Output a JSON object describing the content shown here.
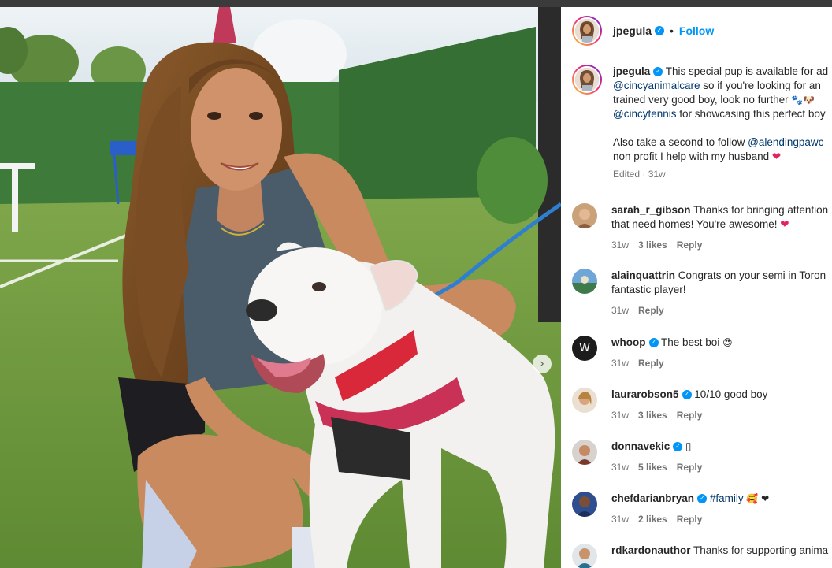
{
  "post": {
    "author": "jpegula",
    "follow_label": "Follow",
    "separator": "•",
    "verified_glyph": "✓",
    "next_glyph": "›",
    "caption": {
      "line1_text": "This special pup is available for ad",
      "line2_mention": "@cincyanimalcare",
      "line2_text": " so if you're looking for an",
      "line3_text": "trained very good boy, look no further",
      "line3_emoji": "🐾🐶",
      "line4_mention": "@cincytennis",
      "line4_text": " for showcasing this perfect boy",
      "line5_text": "Also take a second to follow ",
      "line5_mention": "@alendingpawc",
      "line6_text": "non profit I help with my husband",
      "line6_emoji": "❤",
      "edited": "Edited · 31w"
    }
  },
  "comments": [
    {
      "user": "sarah_r_gibson",
      "verified": false,
      "text": "Thanks for bringing attention",
      "text2": "that need homes! You're awesome!",
      "emoji2": "❤",
      "time": "31w",
      "likes": "3 likes",
      "reply": "Reply"
    },
    {
      "user": "alainquattrin",
      "verified": false,
      "text": "Congrats on your semi in Toron",
      "text2": "fantastic player!",
      "time": "31w",
      "reply": "Reply"
    },
    {
      "user": "whoop",
      "verified": true,
      "text": "The best boi",
      "emoji": "😍",
      "time": "31w",
      "reply": "Reply"
    },
    {
      "user": "laurarobson5",
      "verified": true,
      "text": "10/10 good boy",
      "time": "31w",
      "likes": "3 likes",
      "reply": "Reply"
    },
    {
      "user": "donnavekic",
      "verified": true,
      "text": "▯",
      "time": "31w",
      "likes": "5 likes",
      "reply": "Reply"
    },
    {
      "user": "chefdarianbryan",
      "verified": true,
      "hashtag": "#family",
      "emoji": "🥰 ❤",
      "time": "31w",
      "likes": "2 likes",
      "reply": "Reply"
    },
    {
      "user": "rdkardonauthor",
      "verified": false,
      "text": "Thanks for supporting anima"
    }
  ],
  "whoop_avatar_letter": "W",
  "colors": {
    "accent": "#0095f6",
    "mention": "#00376b",
    "muted": "#737373",
    "heart": "#e0245e"
  }
}
